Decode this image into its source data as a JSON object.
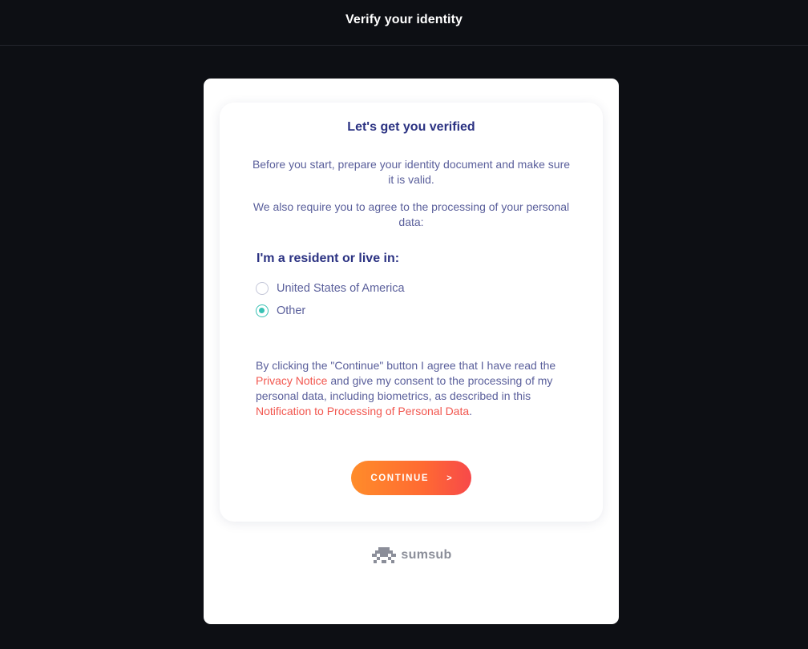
{
  "header": {
    "title": "Verify your identity"
  },
  "card": {
    "title": "Let's get you verified",
    "intro": "Before you start, prepare your identity document and make sure it is valid.",
    "consent_request": "We also require you to agree to the processing of your personal data:",
    "residence_label": "I'm a resident or live in:",
    "options": [
      {
        "label": "United States of America",
        "selected": false
      },
      {
        "label": "Other",
        "selected": true
      }
    ],
    "consent": {
      "part1": "By clicking the \"Continue\" button I agree that I have read the ",
      "link1": "Privacy Notice",
      "part2": " and give my consent to the processing of my personal data, including biometrics, as described in this ",
      "link2": "Notification to Processing of Personal Data",
      "part3": "."
    },
    "continue_label": "CONTINUE",
    "continue_arrow": ">"
  },
  "footer": {
    "brand": "sumsub",
    "brand_icon": "sumsub-logo-icon"
  },
  "colors": {
    "background": "#0d0f14",
    "title": "#2b3282",
    "text": "#5a5f9b",
    "link": "#f2574f",
    "radio_selected": "#39c2b4",
    "button_gradient_start": "#ff8c2a",
    "button_gradient_end": "#f7494a"
  }
}
